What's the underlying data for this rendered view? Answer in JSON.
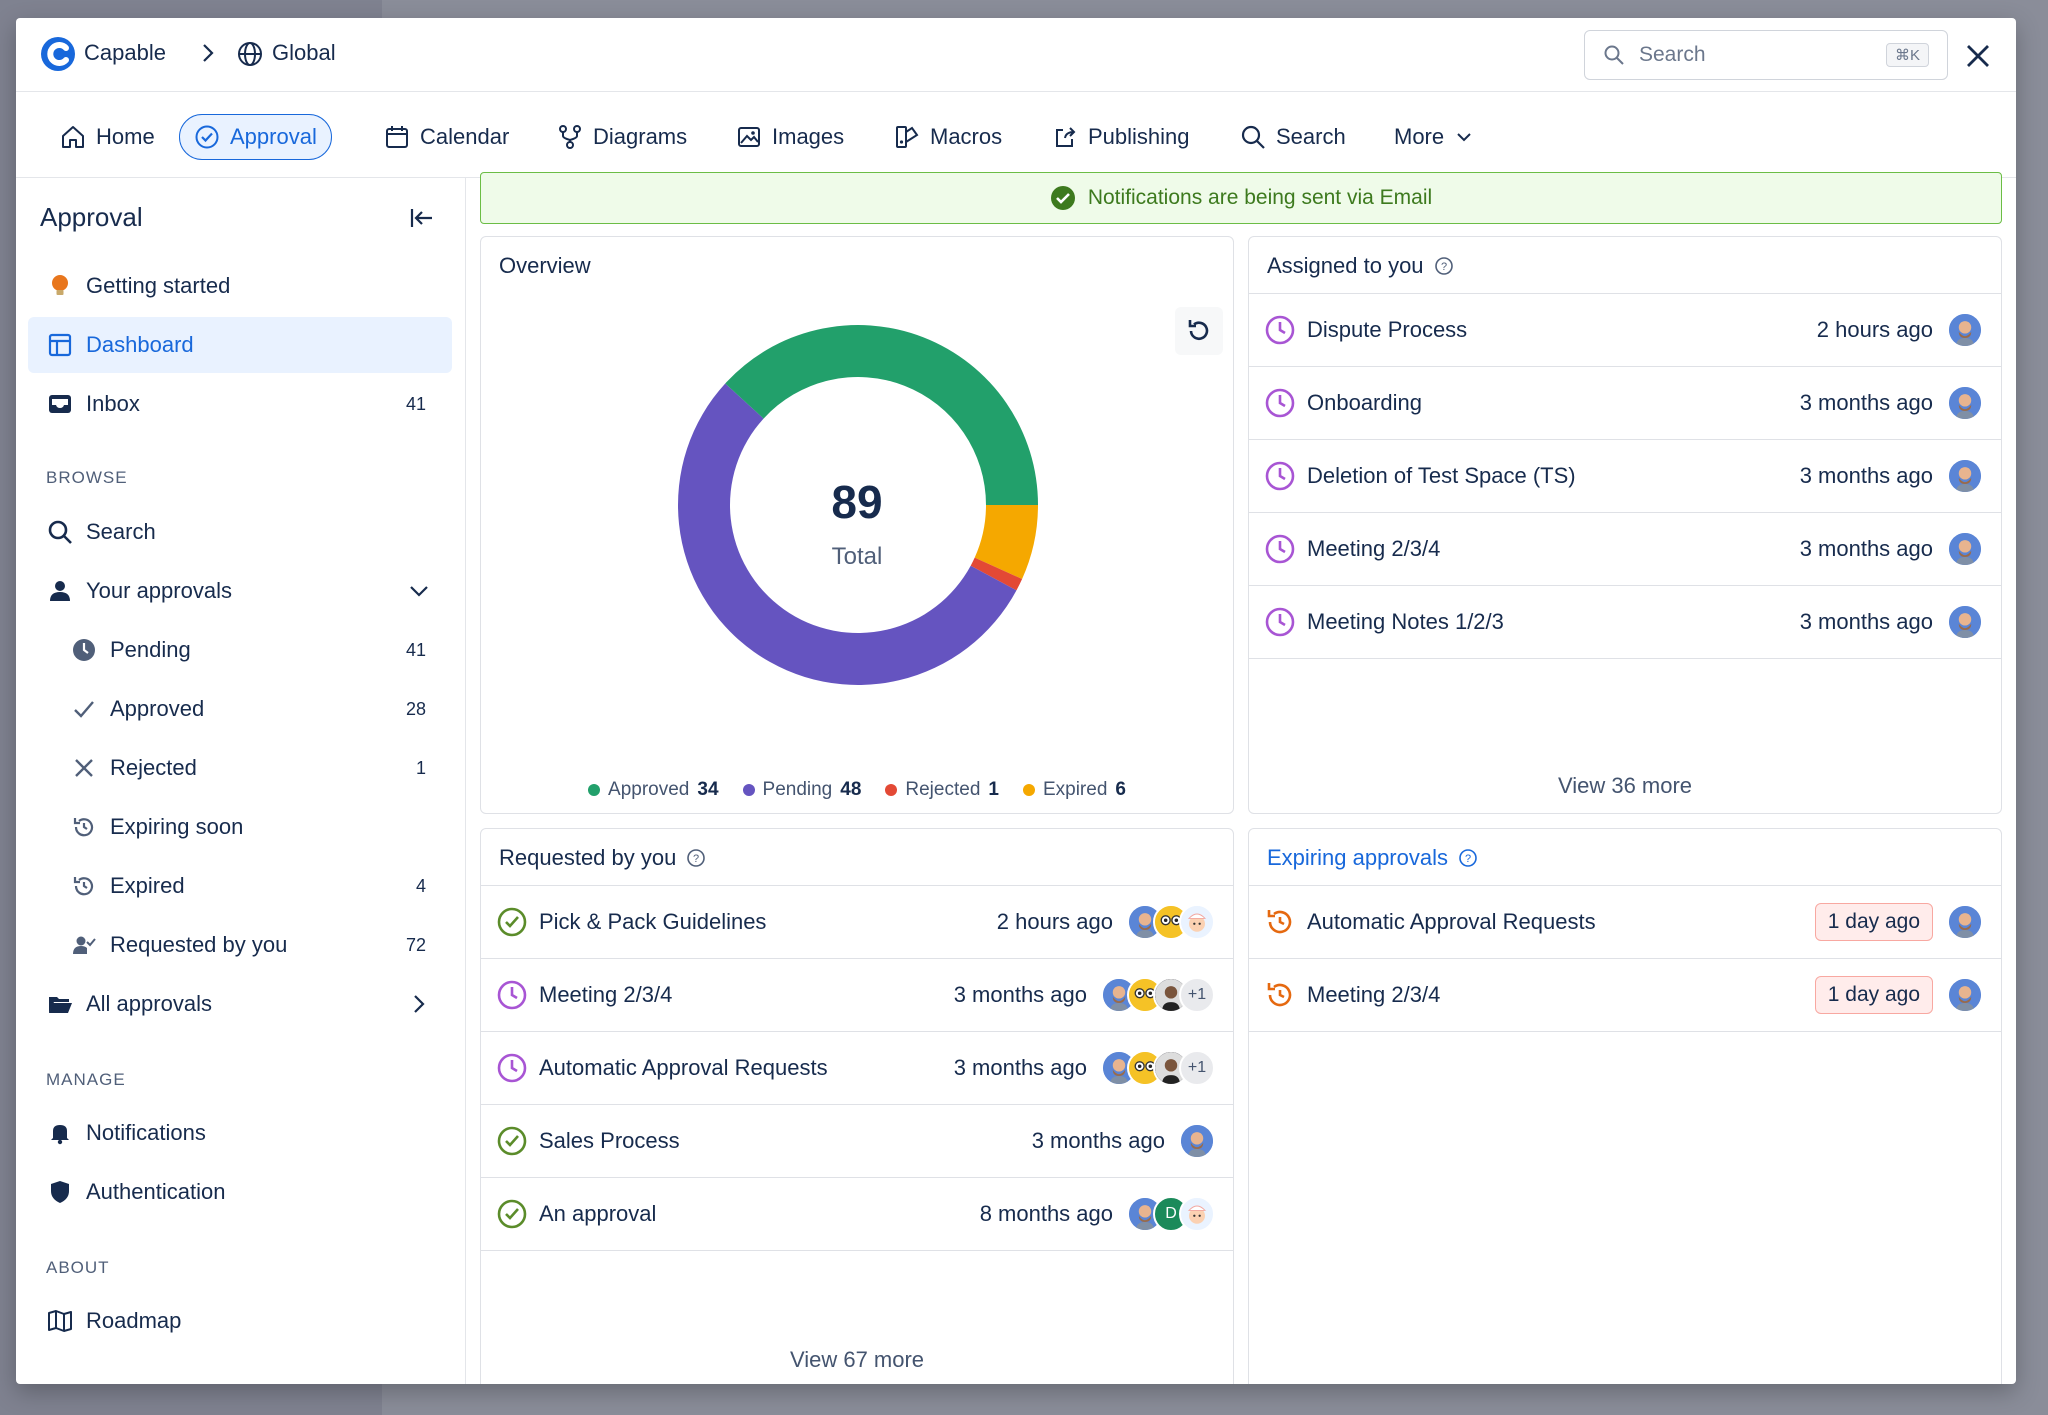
{
  "header": {
    "brand": "Capable",
    "scope": "Global",
    "search_placeholder": "Search",
    "search_shortcut": "⌘K"
  },
  "nav": {
    "items": [
      {
        "label": "Home",
        "icon": "home-icon"
      },
      {
        "label": "Approval",
        "icon": "check-circle-icon",
        "active": true
      },
      {
        "label": "Calendar",
        "icon": "calendar-icon"
      },
      {
        "label": "Diagrams",
        "icon": "diagram-icon"
      },
      {
        "label": "Images",
        "icon": "image-icon"
      },
      {
        "label": "Macros",
        "icon": "macro-icon"
      },
      {
        "label": "Publishing",
        "icon": "share-icon"
      },
      {
        "label": "Search",
        "icon": "search-icon"
      },
      {
        "label": "More",
        "icon": "chevron-down-icon"
      }
    ]
  },
  "sidebar": {
    "title": "Approval",
    "top": [
      {
        "label": "Getting started",
        "icon": "lightbulb-icon"
      },
      {
        "label": "Dashboard",
        "icon": "dashboard-icon",
        "active": true
      },
      {
        "label": "Inbox",
        "icon": "inbox-icon",
        "count": "41"
      }
    ],
    "browse_heading": "BROWSE",
    "browse": [
      {
        "label": "Search",
        "icon": "search-icon"
      },
      {
        "label": "Your approvals",
        "icon": "person-icon"
      }
    ],
    "sub": [
      {
        "label": "Pending",
        "icon": "clock-icon",
        "count": "41"
      },
      {
        "label": "Approved",
        "icon": "check-icon",
        "count": "28"
      },
      {
        "label": "Rejected",
        "icon": "x-icon",
        "count": "1"
      },
      {
        "label": "Expiring soon",
        "icon": "history-icon",
        "count": ""
      },
      {
        "label": "Expired",
        "icon": "history-icon",
        "count": "4"
      },
      {
        "label": "Requested by you",
        "icon": "person-check-icon",
        "count": "72"
      }
    ],
    "all_approvals": "All approvals",
    "manage_heading": "MANAGE",
    "manage": [
      {
        "label": "Notifications",
        "icon": "bell-icon"
      },
      {
        "label": "Authentication",
        "icon": "shield-icon"
      }
    ],
    "about_heading": "ABOUT",
    "about": [
      {
        "label": "Roadmap",
        "icon": "map-icon"
      }
    ]
  },
  "banner": {
    "text": "Notifications are being sent via Email"
  },
  "overview": {
    "title": "Overview",
    "total": "89",
    "total_label": "Total",
    "legend": [
      {
        "label": "Approved",
        "value": "34",
        "color": "#22a06b"
      },
      {
        "label": "Pending",
        "value": "48",
        "color": "#6554c0"
      },
      {
        "label": "Rejected",
        "value": "1",
        "color": "#e34935"
      },
      {
        "label": "Expired",
        "value": "6",
        "color": "#f5a800"
      }
    ]
  },
  "chart_data": {
    "type": "pie",
    "categories": [
      "Approved",
      "Pending",
      "Rejected",
      "Expired"
    ],
    "values": [
      34,
      48,
      1,
      6
    ],
    "colors": [
      "#22a06b",
      "#6554c0",
      "#e34935",
      "#f5a800"
    ],
    "title": "Overview",
    "center_value": 89,
    "center_label": "Total",
    "legend_position": "bottom"
  },
  "assigned": {
    "title": "Assigned to you",
    "rows": [
      {
        "name": "Dispute Process",
        "time": "2 hours ago"
      },
      {
        "name": "Onboarding",
        "time": "3 months ago"
      },
      {
        "name": "Deletion of Test Space (TS)",
        "time": "3 months ago"
      },
      {
        "name": "Meeting 2/3/4",
        "time": "3 months ago"
      },
      {
        "name": "Meeting Notes 1/2/3",
        "time": "3 months ago"
      }
    ],
    "view_more": "View 36 more"
  },
  "requested": {
    "title": "Requested by you",
    "rows": [
      {
        "name": "Pick & Pack Guidelines",
        "time": "2 hours ago",
        "status": "approved"
      },
      {
        "name": "Meeting 2/3/4",
        "time": "3 months ago",
        "status": "pending",
        "extra": "+1"
      },
      {
        "name": "Automatic Approval Requests",
        "time": "3 months ago",
        "status": "pending",
        "extra": "+1"
      },
      {
        "name": "Sales Process",
        "time": "3 months ago",
        "status": "approved"
      },
      {
        "name": "An approval",
        "time": "8 months ago",
        "status": "approved",
        "initial": "D"
      }
    ],
    "view_more": "View 67 more"
  },
  "expiring": {
    "title": "Expiring approvals",
    "rows": [
      {
        "name": "Automatic Approval Requests",
        "badge": "1 day ago"
      },
      {
        "name": "Meeting 2/3/4",
        "badge": "1 day ago"
      }
    ]
  }
}
